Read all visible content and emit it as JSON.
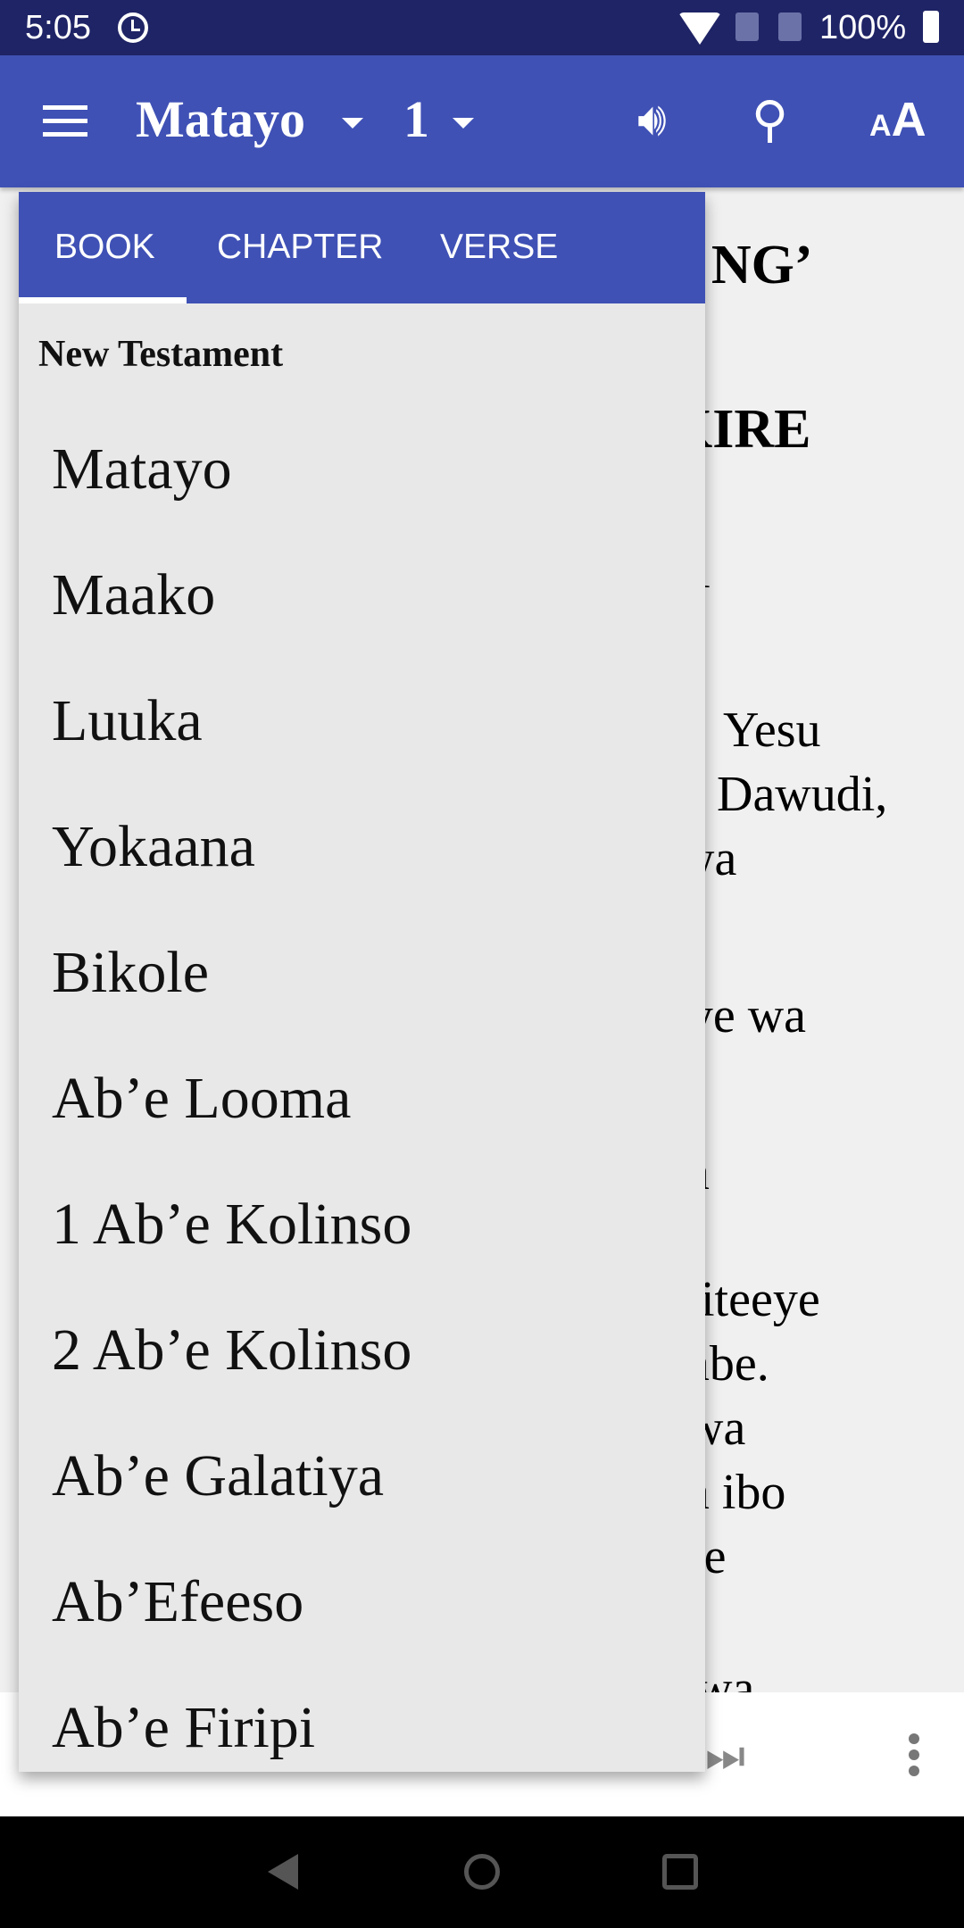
{
  "status_bar": {
    "time": "5:05",
    "battery": "100%",
    "icons": [
      "alarm-icon",
      "wifi-icon",
      "no-sim-icon",
      "no-sim-icon",
      "battery-charging-icon"
    ]
  },
  "toolbar": {
    "book": "Matayo",
    "chapter": "1",
    "icons": [
      "menu-icon",
      "speaker-icon",
      "search-icon",
      "text-size-icon"
    ],
    "color": "#3f51b5"
  },
  "background_text": [
    "A NG’",
    "KIRE",
    "1",
    "Yesu",
    "Dawudi,",
    "wa",
    "eye wa",
    "a",
    "iteeye",
    "abe.",
    "wa",
    "a ibo",
    "re",
    "wa"
  ],
  "popup": {
    "tabs": [
      "BOOK",
      "CHAPTER",
      "VERSE"
    ],
    "active_tab": "BOOK",
    "section": "New Testament",
    "books": [
      "Matayo",
      "Maako",
      "Luuka",
      "Yokaana",
      "Bikole",
      "Ab’e Looma",
      "1 Ab’e Kolinso",
      "2 Ab’e Kolinso",
      "Ab’e Galatiya",
      "Ab’Efeeso",
      "Ab’e Firipi"
    ]
  }
}
